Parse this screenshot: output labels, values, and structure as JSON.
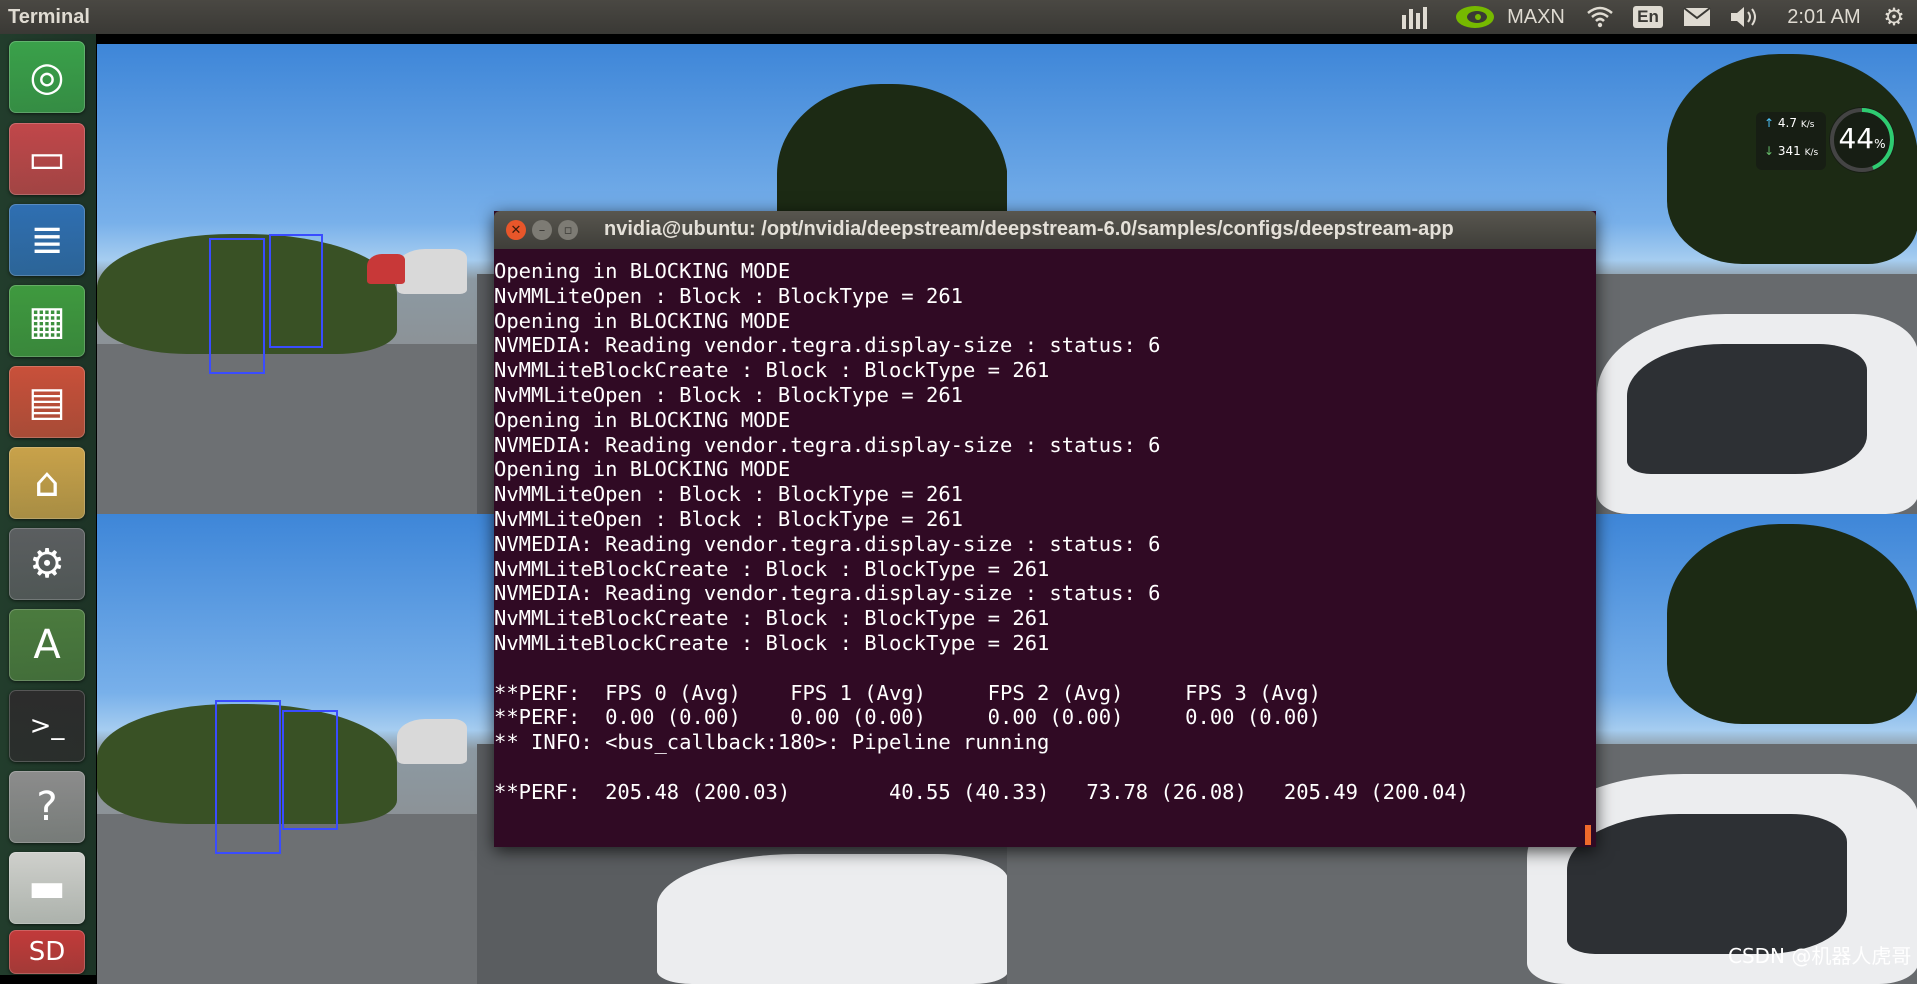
{
  "topbar": {
    "app_title": "Terminal",
    "power_mode": "MAXN",
    "keyboard_layout": "En",
    "time": "2:01 AM",
    "icons": [
      "tegrastats-icon",
      "nvidia-icon",
      "wifi-icon",
      "mail-icon",
      "volume-icon",
      "settings-gear-icon"
    ]
  },
  "launcher": {
    "items": [
      {
        "name": "dash-home",
        "icon": "ubuntu-logo-icon",
        "glyph": "◎",
        "color": "#3aa14a"
      },
      {
        "name": "files",
        "icon": "file-cabinet-icon",
        "glyph": "▭",
        "color": "#c1474a"
      },
      {
        "name": "writer",
        "icon": "document-icon",
        "glyph": "≣",
        "color": "#2f6fb2"
      },
      {
        "name": "calc",
        "icon": "spreadsheet-icon",
        "glyph": "▦",
        "color": "#3f9a3f"
      },
      {
        "name": "impress",
        "icon": "presentation-icon",
        "glyph": "▤",
        "color": "#c9503a"
      },
      {
        "name": "software-center",
        "icon": "shopping-bag-icon",
        "glyph": "⌂",
        "color": "#c9a24a"
      },
      {
        "name": "system-settings",
        "icon": "wrench-gear-icon",
        "glyph": "⚙",
        "color": "#5b5e60"
      },
      {
        "name": "software-updater",
        "icon": "update-icon",
        "glyph": "A",
        "color": "#4b7b3e"
      },
      {
        "name": "terminal",
        "icon": "terminal-icon",
        "glyph": ">_",
        "color": "#2c2c2c"
      },
      {
        "name": "help",
        "icon": "help-icon",
        "glyph": "?",
        "color": "#8c8c8c"
      },
      {
        "name": "drive",
        "icon": "drive-icon",
        "glyph": "▬",
        "color": "#cfd0cc"
      },
      {
        "name": "sd-card",
        "icon": "sd-card-icon",
        "glyph": "SD",
        "color": "#c23a3a"
      }
    ]
  },
  "terminal": {
    "title": "nvidia@ubuntu: /opt/nvidia/deepstream/deepstream-6.0/samples/configs/deepstream-app",
    "lines": [
      "Opening in BLOCKING MODE",
      "NvMMLiteOpen : Block : BlockType = 261",
      "Opening in BLOCKING MODE",
      "NVMEDIA: Reading vendor.tegra.display-size : status: 6",
      "NvMMLiteBlockCreate : Block : BlockType = 261",
      "NvMMLiteOpen : Block : BlockType = 261",
      "Opening in BLOCKING MODE",
      "NVMEDIA: Reading vendor.tegra.display-size : status: 6",
      "Opening in BLOCKING MODE",
      "NvMMLiteOpen : Block : BlockType = 261",
      "NvMMLiteOpen : Block : BlockType = 261",
      "NVMEDIA: Reading vendor.tegra.display-size : status: 6",
      "NvMMLiteBlockCreate : Block : BlockType = 261",
      "NVMEDIA: Reading vendor.tegra.display-size : status: 6",
      "NvMMLiteBlockCreate : Block : BlockType = 261",
      "NvMMLiteBlockCreate : Block : BlockType = 261",
      "",
      "**PERF:  FPS 0 (Avg)    FPS 1 (Avg)     FPS 2 (Avg)     FPS 3 (Avg)",
      "**PERF:  0.00 (0.00)    0.00 (0.00)     0.00 (0.00)     0.00 (0.00)",
      "** INFO: <bus_callback:180>: Pipeline running",
      "",
      "**PERF:  205.48 (200.03)        40.55 (40.33)   73.78 (26.08)   205.49 (200.04)"
    ]
  },
  "net_widget": {
    "upload": "4.7",
    "upload_unit": "K/s",
    "download": "341",
    "download_unit": "K/s",
    "cpu_value": "44",
    "cpu_unit": "%",
    "cpu_fraction": 0.44
  },
  "watermark": "CSDN @机器人虎哥"
}
